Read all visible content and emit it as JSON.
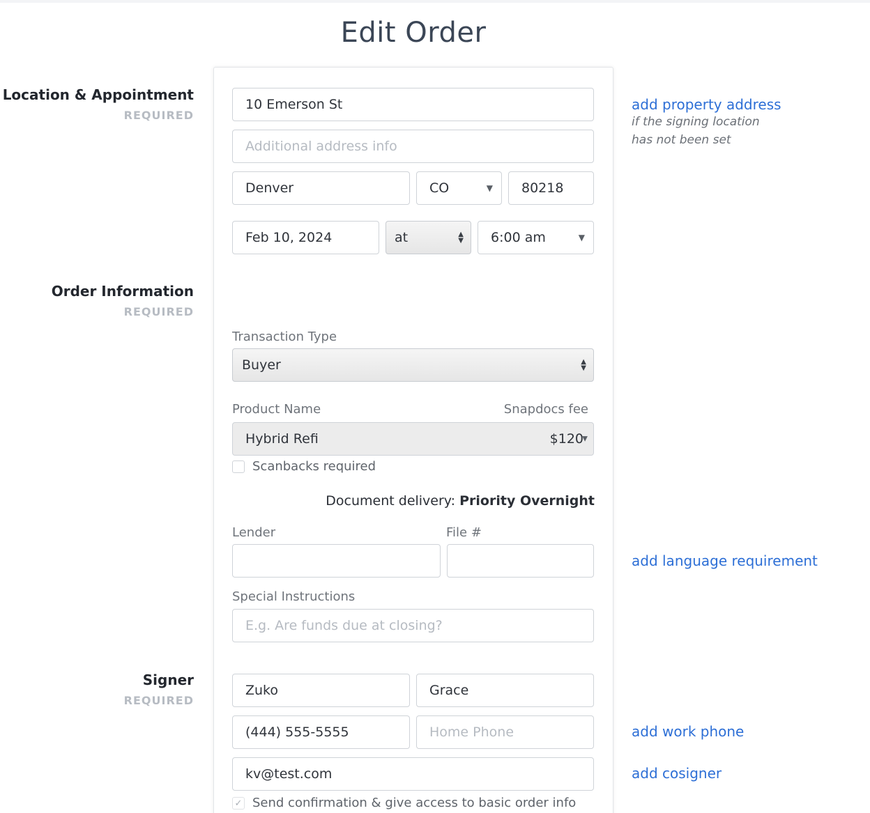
{
  "page": {
    "title": "Edit Order"
  },
  "sections": {
    "location": {
      "name": "Location & Appointment",
      "required": "REQUIRED"
    },
    "order": {
      "name": "Order Information",
      "required": "REQUIRED"
    },
    "signer": {
      "name": "Signer",
      "required": "REQUIRED"
    }
  },
  "location": {
    "address1": "10 Emerson St",
    "address2_placeholder": "Additional address info",
    "city": "Denver",
    "state": "CO",
    "zip": "80218",
    "date": "Feb 10, 2024",
    "at": "at",
    "time": "6:00 am"
  },
  "order": {
    "transaction_type_label": "Transaction Type",
    "transaction_type": "Buyer",
    "product_name_label": "Product Name",
    "snapdocs_fee_label": "Snapdocs fee",
    "product": "Hybrid Refi",
    "fee": "$120",
    "scanbacks_label": "Scanbacks required",
    "delivery_prefix": "Document delivery:",
    "delivery_value": "Priority Overnight",
    "lender_label": "Lender",
    "lender_value": "",
    "file_label": "File #",
    "file_value": "",
    "instructions_label": "Special Instructions",
    "instructions_placeholder": "E.g. Are funds due at closing?"
  },
  "signer": {
    "first_name": "Zuko",
    "last_name": "Grace",
    "phone": "(444) 555-5555",
    "home_phone_placeholder": "Home Phone",
    "email": "kv@test.com",
    "confirm_label": "Send confirmation & give access to basic order info",
    "confirm_checked": true
  },
  "side": {
    "add_property_address": "add property address",
    "property_hint_line1": "if the signing location",
    "property_hint_line2": "has not been set",
    "add_language": "add language requirement",
    "add_work_phone": "add work phone",
    "add_cosigner": "add cosigner"
  },
  "colors": {
    "link": "#2d6fd6",
    "title": "#3b4656",
    "required": "#b7bcc3"
  }
}
